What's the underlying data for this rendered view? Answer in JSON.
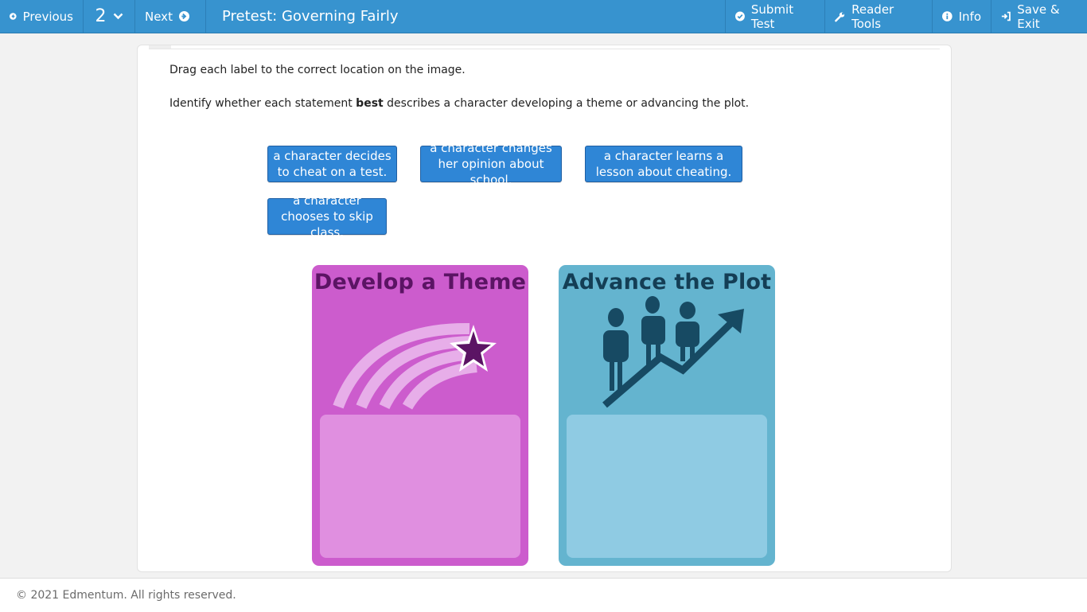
{
  "topbar": {
    "previous_label": "Previous",
    "question_number": "2",
    "next_label": "Next",
    "title": "Pretest: Governing Fairly",
    "submit_label": "Submit Test",
    "reader_tools_label": "Reader Tools",
    "info_label": "Info",
    "save_exit_label": "Save & Exit",
    "icons": [
      "arrow-left-circle-icon",
      "chevron-down-icon",
      "arrow-right-circle-icon",
      "check-circle-icon",
      "wrench-icon",
      "info-circle-icon",
      "sign-in-icon"
    ]
  },
  "question": {
    "instruction": "Drag each label to the correct location on the image.",
    "prompt_before": "Identify whether each statement ",
    "prompt_bold": "best",
    "prompt_after": " describes a character developing a theme or advancing the plot."
  },
  "labels": [
    "a character decides to cheat on a test.",
    "a character changes her opinion about school.",
    "a character learns a lesson about cheating.",
    "a character chooses to skip class."
  ],
  "targets": {
    "theme_title": "Develop a Theme",
    "plot_title": "Advance the Plot"
  },
  "colors": {
    "topbar": "#3793cf",
    "label_tile": "#2f86d6",
    "theme_panel": "#cc5ccd",
    "plot_panel": "#64b4cf"
  },
  "footer": {
    "copyright": "© 2021 Edmentum. All rights reserved."
  }
}
